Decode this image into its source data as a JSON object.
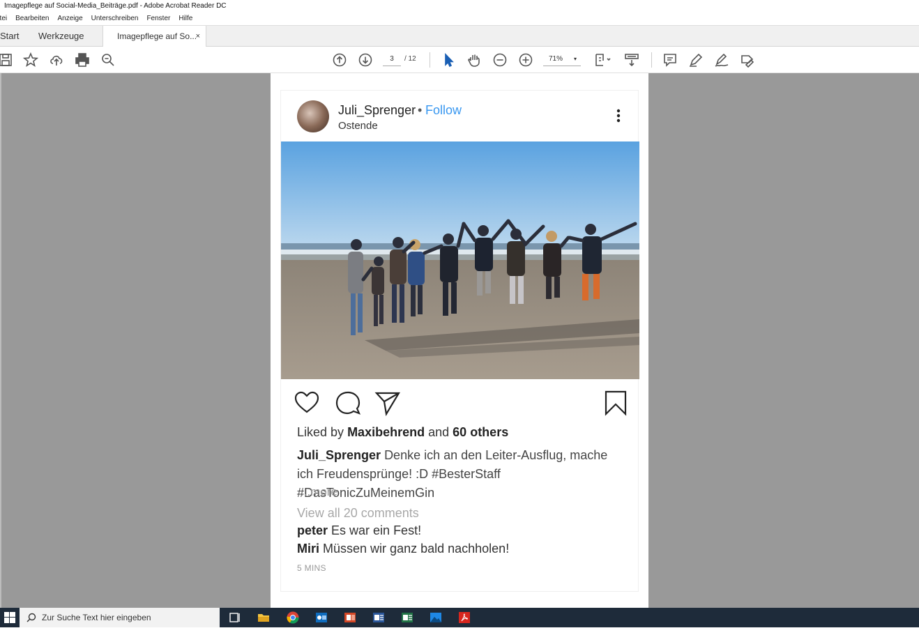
{
  "window": {
    "title": "Imagepflege auf Social-Media_Beiträge.pdf - Adobe Acrobat Reader DC"
  },
  "menu": [
    "atei",
    "Bearbeiten",
    "Anzeige",
    "Unterschreiben",
    "Fenster",
    "Hilfe"
  ],
  "tabs": {
    "start": "Start",
    "tools": "Werkzeuge",
    "document": "Imagepflege auf So...",
    "close": "×"
  },
  "toolbar": {
    "current_page": "3",
    "total_pages": "/ 12",
    "zoom": "71%",
    "zoom_caret": "▾"
  },
  "post": {
    "username": "Juli_Sprenger",
    "separator": "•",
    "follow": "Follow",
    "location": "Ostende",
    "likes": {
      "prefix": "Liked by",
      "user": "Maxibehrend",
      "mid": "and",
      "count": "60 others"
    },
    "caption": {
      "user": "Juli_Sprenger",
      "text": "Denke ich an den Leiter-Ausflug, mache ich Freudensprünge! :D #BesterStaff #DasTonicZuMeinemGin"
    },
    "more": "...more",
    "view_all": "View all 20 comments",
    "comments": [
      {
        "user": "peter",
        "text": "Es war ein Fest!"
      },
      {
        "user": "Miri",
        "text": "Müssen wir ganz bald nachholen!"
      }
    ],
    "time": "5 MINS"
  },
  "taskbar": {
    "search_placeholder": "Zur Suche Text hier eingeben"
  },
  "colors": {
    "follow": "#3897f0",
    "viewer_bg": "#999999",
    "taskbar": "#1e2b3a"
  }
}
